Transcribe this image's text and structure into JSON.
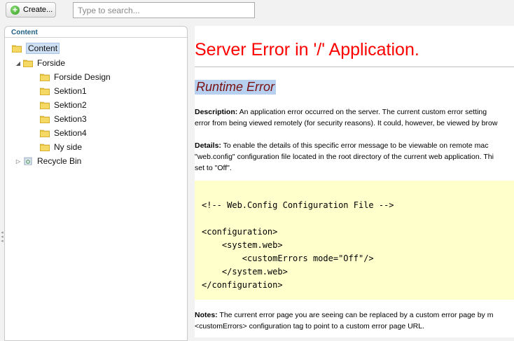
{
  "toolbar": {
    "create_label": "Create...",
    "search_placeholder": "Type to search..."
  },
  "tree": {
    "header": "Content",
    "root": "Content",
    "items": [
      {
        "label": "Forside"
      },
      {
        "label": "Forside Design"
      },
      {
        "label": "Sektion1"
      },
      {
        "label": "Sektion2"
      },
      {
        "label": "Sektion3"
      },
      {
        "label": "Sektion4"
      },
      {
        "label": "Ny side"
      },
      {
        "label": "Recycle Bin"
      }
    ]
  },
  "error": {
    "title": "Server Error in '/' Application.",
    "subtitle": "Runtime Error",
    "description_label": "Description:",
    "description_line1": " An application error occurred on the server. The current custom error setting",
    "description_line2": "error from being viewed remotely (for security reasons). It could, however, be viewed by brow",
    "details_label": "Details:",
    "details_line1": " To enable the details of this specific error message to be viewable on remote mac",
    "details_line2": "\"web.config\" configuration file located in the root directory of the current web application. Thi",
    "details_line3": "set to \"Off\".",
    "code": "<!-- Web.Config Configuration File -->\n\n<configuration>\n    <system.web>\n        <customErrors mode=\"Off\"/>\n    </system.web>\n</configuration>",
    "notes_label": "Notes:",
    "notes_line1": " The current error page you are seeing can be replaced by a custom error page by m",
    "notes_line2": "<customErrors> configuration tag to point to a custom error page URL."
  },
  "colors": {
    "error_title": "#ff0000",
    "subtitle": "#7a1010",
    "code_bg": "#ffffcc"
  }
}
